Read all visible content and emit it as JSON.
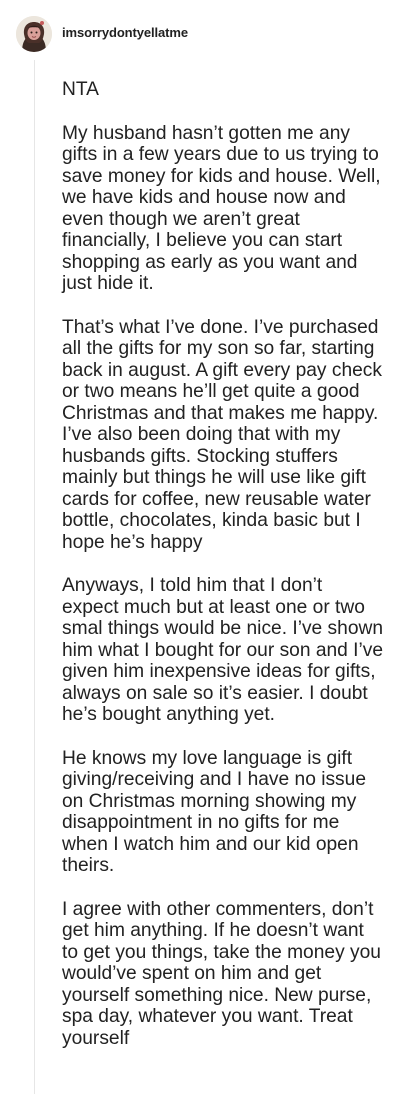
{
  "post": {
    "username": "imsorrydontyellatme",
    "paragraphs": [
      "NTA",
      "My husband hasn’t gotten me any gifts in a few years due to us trying to save money for kids and house. Well, we have kids and house now and even though we aren’t great financially, I believe you can start shopping as early as you want and just hide it.",
      "That’s what I’ve done. I’ve purchased all the gifts for my son so far, starting back in august. A gift every pay check or two means he’ll get quite a good Christmas and that makes me happy. I’ve also been doing that with my husbands gifts. Stocking stuffers mainly but things he will use like gift cards for coffee, new reusable water bottle, chocolates, kinda basic but I hope he’s happy",
      "Anyways, I told him that I don’t expect much but at least one or two smal things would be nice. I’ve shown him what I bought for our son and I’ve given him inexpensive ideas for gifts, always on sale so it’s easier. I doubt he’s bought anything yet.",
      "He knows my love language is gift giving/receiving and I have no issue on Christmas morning showing my disappointment in no gifts for me when I watch him and our kid open theirs.",
      "I agree with other commenters, don’t get him anything. If he doesn’t want to get you things, take the money you would’ve spent on him and get yourself something nice. New purse, spa day, whatever you want. Treat yourself"
    ]
  }
}
